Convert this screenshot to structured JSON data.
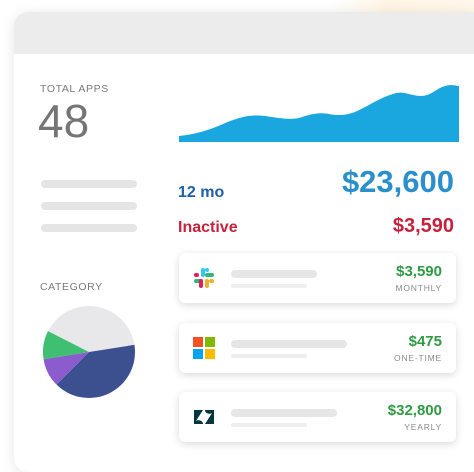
{
  "summary": {
    "total_apps_label": "TOTAL APPS",
    "total_apps_value": "48",
    "category_label": "CATEGORY"
  },
  "spend": {
    "period_label": "12 mo",
    "total_amount": "$23,600",
    "inactive_label": "Inactive",
    "inactive_amount": "$3,590"
  },
  "category_pie": [
    {
      "segment": "gray",
      "color": "#e8e8ea",
      "fraction": 0.4
    },
    {
      "segment": "navy",
      "color": "#3c4f8f",
      "fraction": 0.4
    },
    {
      "segment": "purple",
      "color": "#8a5ccd",
      "fraction": 0.1
    },
    {
      "segment": "green",
      "color": "#3fbf72",
      "fraction": 0.1
    }
  ],
  "apps": [
    {
      "icon": "slack-icon",
      "price": "$3,590",
      "period": "MONTHLY"
    },
    {
      "icon": "microsoft-icon",
      "price": "$475",
      "period": "ONE-TIME"
    },
    {
      "icon": "zendesk-icon",
      "price": "$32,800",
      "period": "YEARLY"
    }
  ],
  "colors": {
    "accent_blue": "#2a8fcb",
    "sparkline": "#1aa7df",
    "inactive_red": "#c6223c",
    "price_green": "#2e9a43"
  }
}
